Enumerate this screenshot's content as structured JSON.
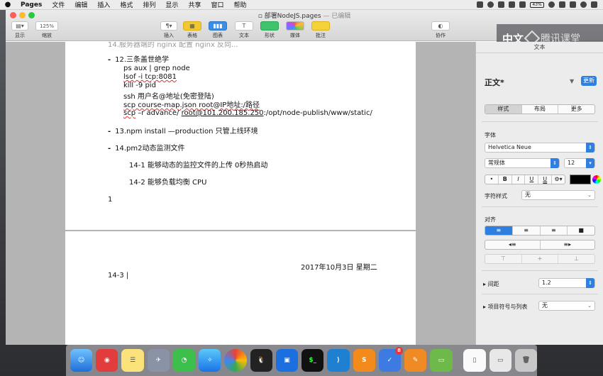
{
  "menubar": {
    "app": "Pages",
    "items": [
      "文件",
      "编辑",
      "插入",
      "格式",
      "排列",
      "显示",
      "共享",
      "窗口",
      "帮助"
    ],
    "battery": "43%"
  },
  "window": {
    "title": "部署NodeJS.pages",
    "status": "— 已编辑"
  },
  "toolbar": {
    "view_label": "显示",
    "zoom_value": "125%",
    "zoom_label": "缩放",
    "insert_label": "插入",
    "table_label": "表格",
    "chart_label": "图表",
    "text_label": "文本",
    "shape_label": "形状",
    "media_label": "媒体",
    "comment_label": "批注",
    "collab_label": "协作"
  },
  "watermark": {
    "text1": "中文",
    "text2": "腾讯课堂"
  },
  "document": {
    "cutoff_line": "14.服务器端的 nginx 配置 nginx 反向...",
    "heading12": "12.三条盖世绝学",
    "cmds": [
      "ps aux | grep node",
      "lsof -i tcp:8081",
      "kill -9 pid",
      "ssh 用户名@地址(免密登陆)",
      "scp course-map.json root@IP地址:/路径"
    ],
    "cmd6_a": "scp",
    "cmd6_b": " –r advance/ ",
    "cmd6_c": "root@101.200.185.250",
    "cmd6_d": ":/opt/node-publish/www/static/",
    "item13": "13.npm install —production 只管上线环境",
    "item14": "14.pm2动态监测文件",
    "sub1": "14-1 能够动态的监控文件的上传 0秒热启动",
    "sub2": "14-2 能够负载均衡 CPU",
    "page_number": "1",
    "date": "2017年10月3日 星期二",
    "cursor_line": "14-3"
  },
  "inspector": {
    "header": "文本",
    "style_name": "正文*",
    "update_btn": "更新",
    "tabs": [
      "样式",
      "布局",
      "更多"
    ],
    "font_label": "字体",
    "font_name": "Helvetica Neue",
    "font_style": "常规体",
    "font_size": "12",
    "format_buttons": [
      "•",
      "B",
      "I",
      "U",
      "U",
      "⚙▾"
    ],
    "char_style_label": "字符样式",
    "char_style_value": "无",
    "align_label": "对齐",
    "spacing_label": "间距",
    "spacing_value": "1.2",
    "bullets_label": "项目符号与列表",
    "bullets_value": "无"
  },
  "colors": {
    "accent": "#2e7fe0",
    "spell_error": "#e03030"
  }
}
